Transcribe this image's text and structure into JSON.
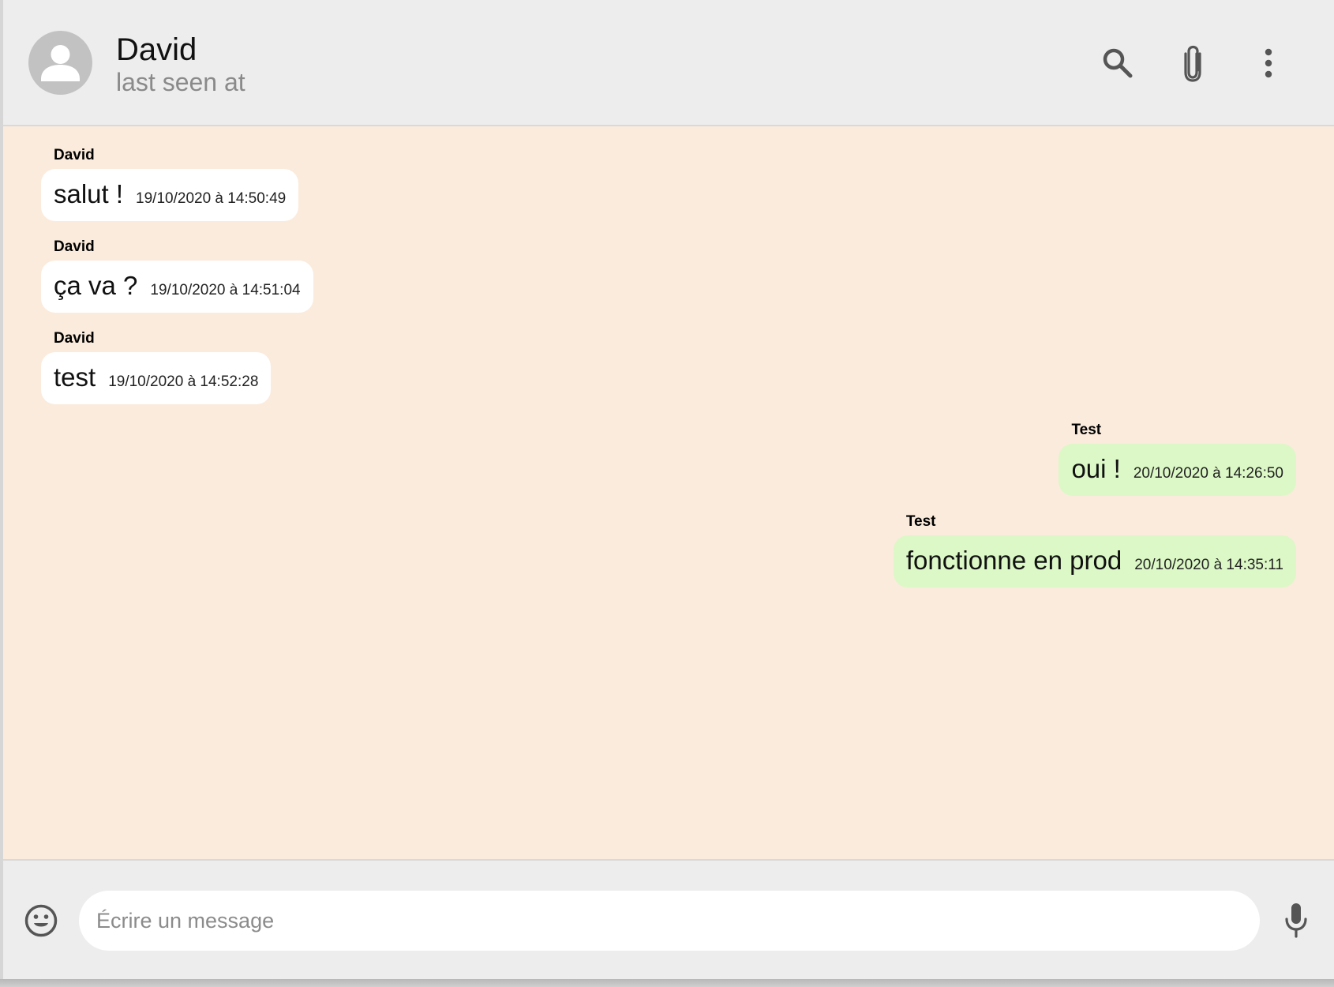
{
  "header": {
    "contact_name": "David",
    "status": "last seen at",
    "actions": [
      {
        "name": "search-icon"
      },
      {
        "name": "paperclip-icon"
      },
      {
        "name": "more-vert-icon"
      }
    ]
  },
  "messages": [
    {
      "sender": "David",
      "text": "salut !",
      "time": "19/10/2020 à 14:50:49",
      "direction": "incoming"
    },
    {
      "sender": "David",
      "text": "ça va ?",
      "time": "19/10/2020 à 14:51:04",
      "direction": "incoming"
    },
    {
      "sender": "David",
      "text": "test",
      "time": "19/10/2020 à 14:52:28",
      "direction": "incoming"
    },
    {
      "sender": "Test",
      "text": "oui !",
      "time": "20/10/2020 à 14:26:50",
      "direction": "outgoing"
    },
    {
      "sender": "Test",
      "text": "fonctionne en prod",
      "time": "20/10/2020 à 14:35:11",
      "direction": "outgoing"
    }
  ],
  "composer": {
    "placeholder": "Écrire un message",
    "value": "",
    "emoji_icon": "emoji-icon",
    "mic_icon": "mic-icon"
  },
  "colors": {
    "chat_background": "#fbebdc",
    "incoming_bubble": "#ffffff",
    "outgoing_bubble": "#dcf8c6",
    "bar_background": "#ededed"
  }
}
